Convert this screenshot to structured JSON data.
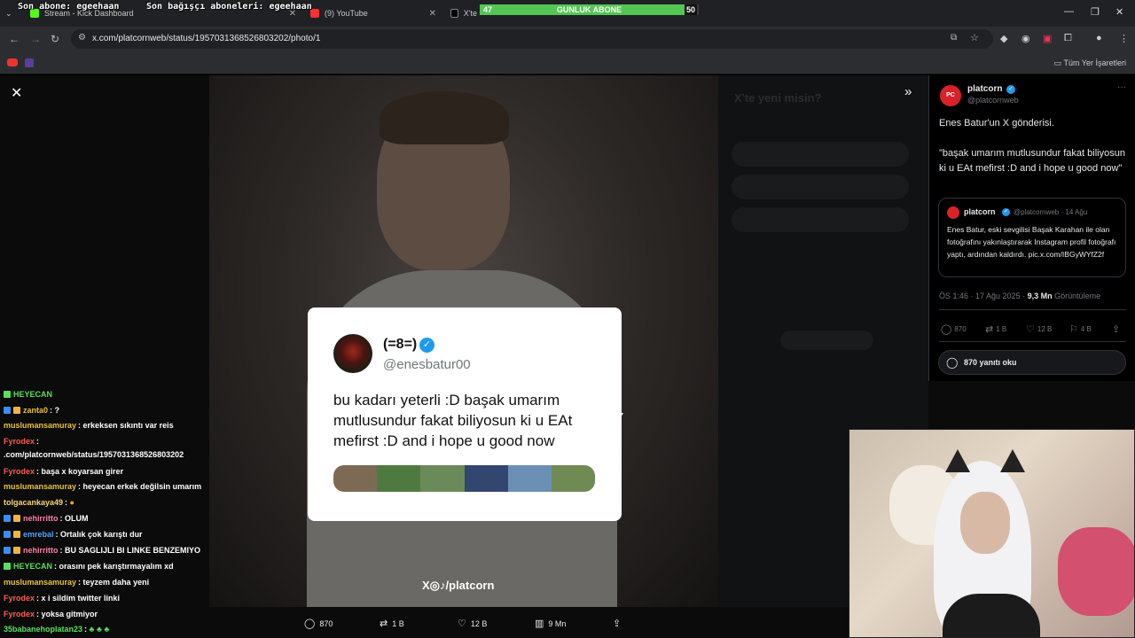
{
  "stream_overlay": {
    "last_follower": "Son abone: egeehaan",
    "last_donor": "Son bağışçı aboneleri: egeehaan"
  },
  "browser": {
    "tabs": [
      {
        "label": "Stream - Kick Dashboard"
      },
      {
        "label": "(9) YouTube"
      },
      {
        "label": "X'te"
      }
    ],
    "url": "x.com/platcornweb/status/1957031368526803202/photo/1",
    "bookmarks_all": "Tüm Yer İşaretleri"
  },
  "goal_bar": {
    "label": "GUNLUK ABONE",
    "current": "47",
    "target": "50",
    "fraction": 0.94
  },
  "ghost": {
    "title": "X'te yeni misin?"
  },
  "quoted_card": {
    "name": "(=8=)",
    "handle": "@enesbatur00",
    "text": "bu kadarı yeterli :D başak umarım mutlusundur fakat biliyosun ki u EAt mefirst :D  and i hope u good now"
  },
  "watermark": "X◎♪/platcorn",
  "photo_actions": {
    "replies": "870",
    "reposts": "1 B",
    "likes": "12 B",
    "views": "9 Mn"
  },
  "chat": [
    {
      "user": "HEYECAN",
      "msg": "",
      "color": "lime"
    },
    {
      "user": "zanta0",
      "msg": ": ?",
      "color": "gold"
    },
    {
      "user": "muslumansamuray",
      "msg": ": erkeksen sıkıntı var reis",
      "color": "gold"
    },
    {
      "user": "Fyrodex",
      "msg": ":",
      "color": "red"
    },
    {
      "user": "",
      "msg": ".com/platcornweb/status/1957031368526803202",
      "color": "red"
    },
    {
      "user": "Fyrodex",
      "msg": ": başa x koyarsan girer",
      "color": "red"
    },
    {
      "user": "muslumansamuray",
      "msg": ": heyecan erkek değilsin umarım",
      "color": "gold"
    },
    {
      "user": "tolgacankaya49",
      "msg": ":",
      "color": "yellow"
    },
    {
      "user": "nehirritto",
      "msg": ": OLUM",
      "color": "pink"
    },
    {
      "user": "emrebal",
      "msg": ": Ortalık çok karıştı dur",
      "color": "blue"
    },
    {
      "user": "nehirritto",
      "msg": ": BU SAGLIJLI BI LINKE BENZEMIYO",
      "color": "pink"
    },
    {
      "user": "HEYECAN",
      "msg": ": orasını pek karıştırmayalım xd",
      "color": "lime"
    },
    {
      "user": "muslumansamuray",
      "msg": ": teyzem daha yeni",
      "color": "gold"
    },
    {
      "user": "Fyrodex",
      "msg": ": x i sildim twitter linki",
      "color": "red"
    },
    {
      "user": "Fyrodex",
      "msg": ": yoksa gitmiyor",
      "color": "red"
    },
    {
      "user": "35babanehoplatan23",
      "msg": ":",
      "color": "lime"
    }
  ],
  "sidebar": {
    "name": "platcorn",
    "handle": "@platcornweb",
    "body_line1": "Enes Batur'un X gönderisi.",
    "body_line2": "\"başak umarım mutlusundur fakat biliyosun ki u EAt mefirst :D  and i hope u good now\"",
    "quote": {
      "name": "platcorn",
      "meta": "@platcornweb · 14 Ağu",
      "text": "Enes Batur, eski sevgilisi Başak Karahan ile olan fotoğrafını yakınlaştırarak Instagram profil fotoğrafı yaptı, ardından kaldırdı. pic.x.com/IBGyWYfZ2f"
    },
    "time": "ÖS 1:46 · 17 Ağu 2025 · ",
    "views_value": "9,3 Mn",
    "views_label": " Görüntüleme",
    "actions": {
      "replies": "870",
      "reposts": "1 B",
      "likes": "12 B",
      "bookmarks": "4 B"
    },
    "reply_button": "870 yanıtı oku"
  }
}
